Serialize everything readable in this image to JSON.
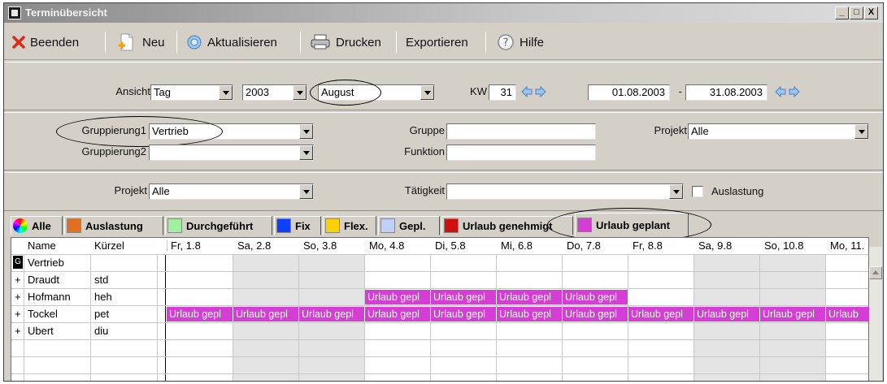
{
  "window": {
    "title": "Terminübersicht",
    "controls": {
      "minimize": "_",
      "maximize": "□",
      "close": "X"
    }
  },
  "toolbar": {
    "beenden": "Beenden",
    "neu": "Neu",
    "aktualisieren": "Aktualisieren",
    "drucken": "Drucken",
    "exportieren": "Exportieren",
    "hilfe": "Hilfe"
  },
  "filter1": {
    "ansicht_label": "Ansicht",
    "ansicht_value": "Tag",
    "year_value": "2003",
    "month_value": "August",
    "kw_label": "KW",
    "kw_value": "31",
    "date_from": "01.08.2003",
    "date_sep": "-",
    "date_to": "31.08.2003"
  },
  "filter2": {
    "gruppierung1_label": "Gruppierung1",
    "gruppierung1_value": "Vertrieb",
    "gruppierung2_label": "Gruppierung2",
    "gruppierung2_value": "",
    "gruppe_label": "Gruppe",
    "gruppe_value": "",
    "funktion_label": "Funktion",
    "funktion_value": "",
    "projekt_label": "Projekt",
    "projekt_value": "Alle"
  },
  "filter3": {
    "projekt_label": "Projekt",
    "projekt_value": "Alle",
    "taetigkeit_label": "Tätigkeit",
    "taetigkeit_value": "",
    "auslastung_label": "Auslastung"
  },
  "tabs": [
    {
      "label": "Alle",
      "color": "rainbow"
    },
    {
      "label": "Auslastung",
      "color": "#e07020"
    },
    {
      "label": "Durchgeführt",
      "color": "#a0f0a0"
    },
    {
      "label": "Fix",
      "color": "#1040ff"
    },
    {
      "label": "Flex.",
      "color": "#ffd000"
    },
    {
      "label": "Gepl.",
      "color": "#c0d0f8"
    },
    {
      "label": "Urlaub genehmigt",
      "color": "#d01010"
    },
    {
      "label": "Urlaub geplant",
      "color": "#d43ed4"
    }
  ],
  "grid": {
    "headers": {
      "name": "Name",
      "kuerzel": "Kürzel"
    },
    "days": [
      "Fr, 1.8",
      "Sa, 2.8",
      "So, 3.8",
      "Mo, 4.8",
      "Di, 5.8",
      "Mi, 6.8",
      "Do, 7.8",
      "Fr, 8.8",
      "Sa, 9.8",
      "So, 10.8",
      "Mo, 11."
    ],
    "rows": [
      {
        "expander": "G",
        "name": "Vertrieb",
        "kuerzel": ""
      },
      {
        "expander": "+",
        "name": "Draudt",
        "kuerzel": "std"
      },
      {
        "expander": "+",
        "name": "Hofmann",
        "kuerzel": "heh"
      },
      {
        "expander": "+",
        "name": "Tockel",
        "kuerzel": "pet"
      },
      {
        "expander": "+",
        "name": "Ubert",
        "kuerzel": "diu"
      }
    ],
    "event_label": "Urlaub gepl",
    "event_label_last": "Urlaub"
  }
}
